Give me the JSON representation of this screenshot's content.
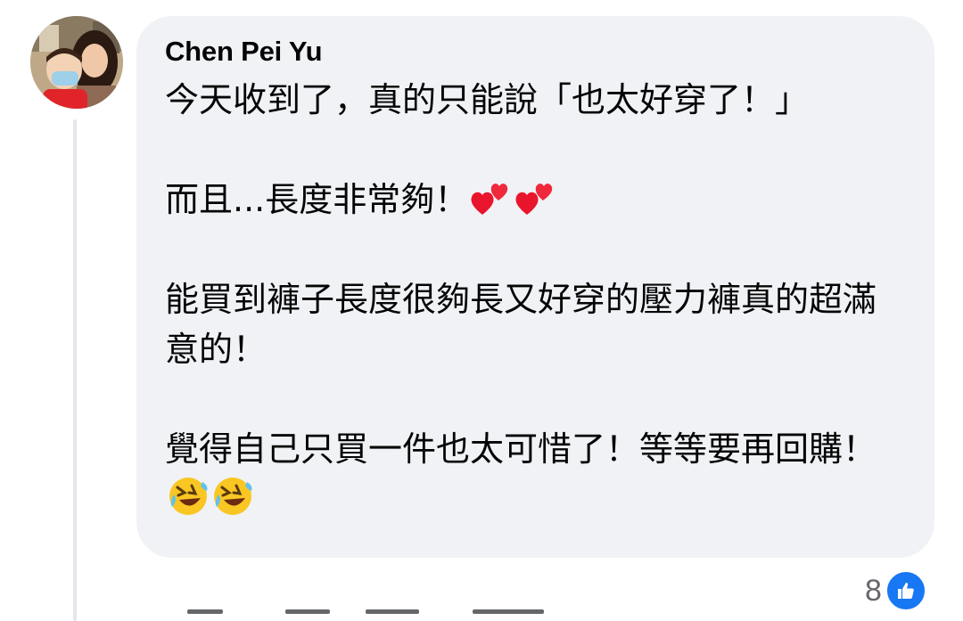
{
  "comment": {
    "author": "Chen Pei Yu",
    "paragraphs": [
      {
        "text": "今天收到了，真的只能說「也太好穿了！」",
        "emoji": []
      },
      {
        "text": "而且...長度非常夠！",
        "emoji": [
          "two-hearts-icon",
          "two-hearts-icon"
        ]
      },
      {
        "text": "能買到褲子長度很夠長又好穿的壓力褲真的超滿意的！",
        "emoji": []
      },
      {
        "text": "覺得自己只買一件也太可惜了！等等要再回購！",
        "emoji": [
          "rolling-laughing-icon",
          "rolling-laughing-icon"
        ]
      }
    ]
  },
  "reactions": {
    "count": "8",
    "type": "like-icon"
  },
  "colors": {
    "bubble": "#f0f2f5",
    "text": "#050505",
    "secondary": "#65676b",
    "like_blue": "#1877f2"
  }
}
